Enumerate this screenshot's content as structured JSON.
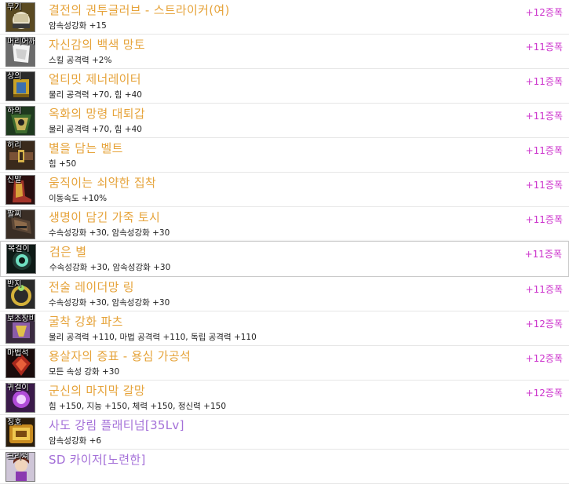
{
  "colors": {
    "epic_name": "#e6a33a",
    "special_name": "#a470d8",
    "tier": "#cc33cc"
  },
  "items": [
    {
      "slot": "무기",
      "name": "결전의 권투글러브 - 스트라이커(여)",
      "stat": "암속성강화 +15",
      "tier": "+12증폭",
      "rarity": "epic",
      "icon": "glove-weapon-icon"
    },
    {
      "slot": "머리어깨",
      "name": "자신감의 백색 망토",
      "stat": "스킬 공격력 +2%",
      "tier": "+11증폭",
      "rarity": "epic",
      "icon": "white-cape-icon"
    },
    {
      "slot": "상의",
      "name": "얼티밋 제너레이터",
      "stat": "물리 공격력 +70, 힘 +40",
      "tier": "+11증폭",
      "rarity": "epic",
      "icon": "generator-armor-icon"
    },
    {
      "slot": "하의",
      "name": "옥화의 망령 대퇴갑",
      "stat": "물리 공격력 +70, 힘 +40",
      "tier": "+11증폭",
      "rarity": "epic",
      "icon": "thigh-guard-icon"
    },
    {
      "slot": "허리",
      "name": "별을 담는 벨트",
      "stat": "힘 +50",
      "tier": "+11증폭",
      "rarity": "epic",
      "icon": "belt-icon"
    },
    {
      "slot": "신발",
      "name": "움직이는 쇠약한 집착",
      "stat": "이동속도 +10%",
      "tier": "+11증폭",
      "rarity": "epic",
      "icon": "boots-icon"
    },
    {
      "slot": "팔찌",
      "name": "생명이 담긴 가죽 토시",
      "stat": "수속성강화 +30, 암속성강화 +30",
      "tier": "+11증폭",
      "rarity": "epic",
      "icon": "bracelet-icon"
    },
    {
      "slot": "목걸이",
      "name": "검은 별",
      "stat": "수속성강화 +30, 암속성강화 +30",
      "tier": "+11증폭",
      "rarity": "epic",
      "icon": "necklace-icon"
    },
    {
      "slot": "반지",
      "name": "전술 레이더망 링",
      "stat": "수속성강화 +30, 암속성강화 +30",
      "tier": "+11증폭",
      "rarity": "epic",
      "icon": "ring-icon"
    },
    {
      "slot": "보조장비",
      "name": "굴착 강화 파츠",
      "stat": "물리 공격력 +110, 마법 공격력 +110, 독립 공격력 +110",
      "tier": "+12증폭",
      "rarity": "epic",
      "icon": "support-parts-icon"
    },
    {
      "slot": "마법석",
      "name": "용살자의 증표 - 용심 가공석",
      "stat": "모든 속성 강화 +30",
      "tier": "+12증폭",
      "rarity": "epic",
      "icon": "magic-stone-icon"
    },
    {
      "slot": "귀걸이",
      "name": "군신의 마지막 갈망",
      "stat": "힘 +150, 지능 +150, 체력 +150, 정신력 +150",
      "tier": "+12증폭",
      "rarity": "epic",
      "icon": "earring-icon"
    },
    {
      "slot": "칭호",
      "name": "사도 강림 플래티넘[35Lv]",
      "stat": "암속성강화 +6",
      "tier": "",
      "rarity": "special",
      "icon": "title-emblem-icon"
    },
    {
      "slot": "크리쳐",
      "name": "SD 카이저[노련한]",
      "stat": "",
      "tier": "",
      "rarity": "special",
      "icon": "creature-icon"
    }
  ]
}
